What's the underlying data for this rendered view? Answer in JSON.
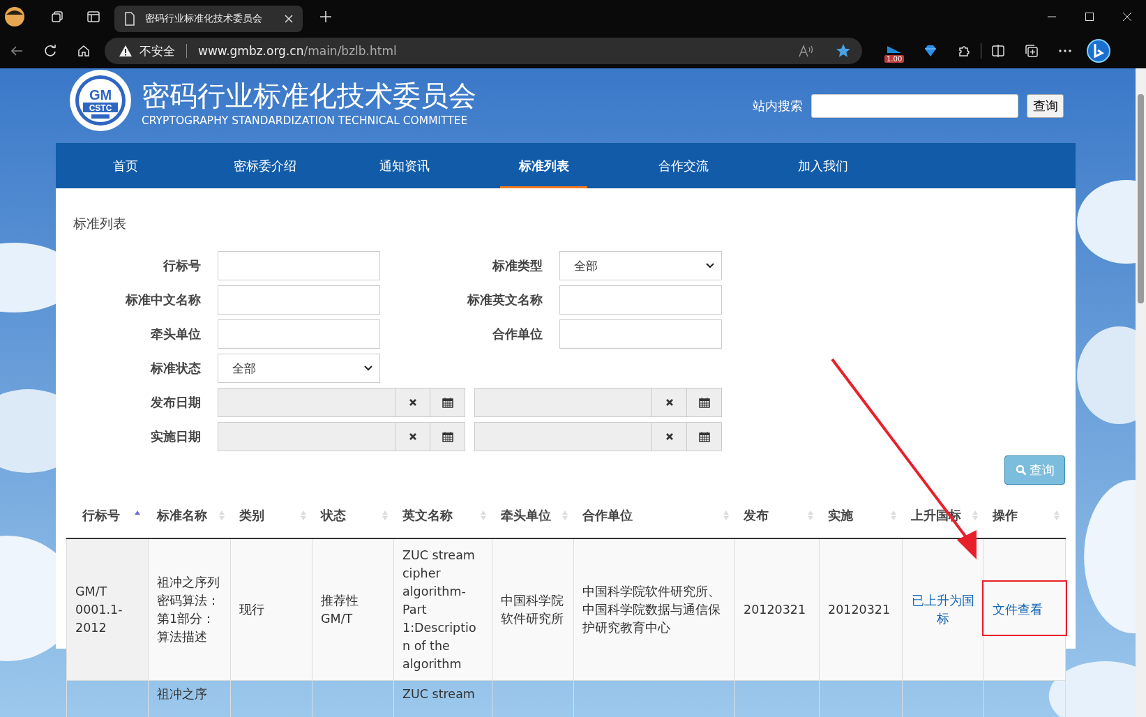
{
  "browser": {
    "tab_title": "密码行业标准化技术委员会",
    "security": "不安全",
    "url_host": "www.gmbz.org.cn",
    "url_path": "/main/bzlb.html",
    "extension_badge": "1.00"
  },
  "header": {
    "title": "密码行业标准化技术委员会",
    "subtitle": "CRYPTOGRAPHY STANDARDIZATION TECHNICAL COMMITTEE",
    "logo_top": "GM",
    "logo_bottom": "CSTC",
    "search_label": "站内搜索",
    "search_button": "查询"
  },
  "nav": [
    {
      "label": "首页",
      "selected": false
    },
    {
      "label": "密标委介绍",
      "selected": false
    },
    {
      "label": "通知资讯",
      "selected": false
    },
    {
      "label": "标准列表",
      "selected": true
    },
    {
      "label": "合作交流",
      "selected": false
    },
    {
      "label": "加入我们",
      "selected": false
    }
  ],
  "page_title": "标准列表",
  "form": {
    "rows": [
      [
        {
          "label": "行标号",
          "kind": "text"
        },
        {
          "label": "标准类型",
          "kind": "select",
          "value": "全部"
        }
      ],
      [
        {
          "label": "标准中文名称",
          "kind": "text"
        },
        {
          "label": "标准英文名称",
          "kind": "text"
        }
      ],
      [
        {
          "label": "牵头单位",
          "kind": "text"
        },
        {
          "label": "合作单位",
          "kind": "text"
        }
      ],
      [
        {
          "label": "标准状态",
          "kind": "select",
          "value": "全部"
        }
      ],
      [
        {
          "label": "发布日期",
          "kind": "date-range"
        }
      ],
      [
        {
          "label": "实施日期",
          "kind": "date-range"
        }
      ]
    ],
    "query_button": "查询"
  },
  "table": {
    "columns": [
      {
        "label": "行标号",
        "sorted": true
      },
      {
        "label": "标准名称",
        "sorted": false
      },
      {
        "label": "类别",
        "sorted": false
      },
      {
        "label": "状态",
        "sorted": false
      },
      {
        "label": "英文名称",
        "sorted": false
      },
      {
        "label": "牵头单位",
        "sorted": false
      },
      {
        "label": "合作单位",
        "sorted": false
      },
      {
        "label": "发布",
        "sorted": false
      },
      {
        "label": "实施",
        "sorted": false
      },
      {
        "label": "上升国标",
        "sorted": false
      },
      {
        "label": "操作",
        "sorted": false
      }
    ],
    "rows": [
      {
        "cells": [
          "GM/T 0001.1-2012",
          "祖冲之序列密码算法：第1部分：算法描述",
          "现行",
          "推荐性GM/T",
          "ZUC stream cipher algorithm-Part 1:Description of the algorithm",
          "中国科学院软件研究所",
          "中国科学院软件研究所、中国科学院数据与通信保护研究教育中心",
          "20120321",
          "20120321",
          "已上升为国标",
          "文件查看"
        ]
      },
      {
        "cells": [
          "",
          "祖冲之序",
          "",
          "",
          "ZUC stream",
          "",
          "",
          "",
          "",
          "",
          ""
        ]
      }
    ]
  }
}
